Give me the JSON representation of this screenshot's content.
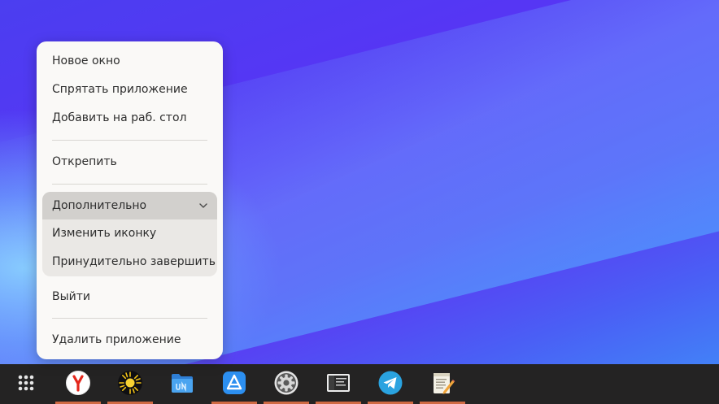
{
  "context_menu": {
    "items": [
      {
        "label": "Новое окно"
      },
      {
        "label": "Спрятать приложение"
      },
      {
        "label": "Добавить на раб. стол"
      },
      {
        "label": "Открепить"
      }
    ],
    "submenu": {
      "label": "Дополнительно",
      "items": [
        {
          "label": "Изменить иконку"
        },
        {
          "label": "Принудительно завершить"
        }
      ]
    },
    "quit_label": "Выйти",
    "remove_label": "Удалить приложение"
  },
  "dock": {
    "items": [
      {
        "name": "show-apps",
        "icon": "app-grid-icon",
        "running": false
      },
      {
        "name": "yandex-browser",
        "icon": "yandex-icon",
        "running": true
      },
      {
        "name": "sun-app",
        "icon": "sun-icon",
        "running": true
      },
      {
        "name": "files",
        "icon": "folder-icon",
        "running": false
      },
      {
        "name": "app-store",
        "icon": "store-icon",
        "running": true
      },
      {
        "name": "settings",
        "icon": "gear-icon",
        "running": true
      },
      {
        "name": "system-monitor",
        "icon": "monitor-icon",
        "running": true
      },
      {
        "name": "telegram",
        "icon": "telegram-icon",
        "running": true
      },
      {
        "name": "text-editor",
        "icon": "text-editor-icon",
        "running": true
      }
    ]
  },
  "colors": {
    "menu_bg": "#faf9f7",
    "submenu_header_bg": "#d2d0cd",
    "dock_bg": "#242323",
    "running_indicator": "#d06a43",
    "wallpaper_primary": "#5a33f6"
  }
}
